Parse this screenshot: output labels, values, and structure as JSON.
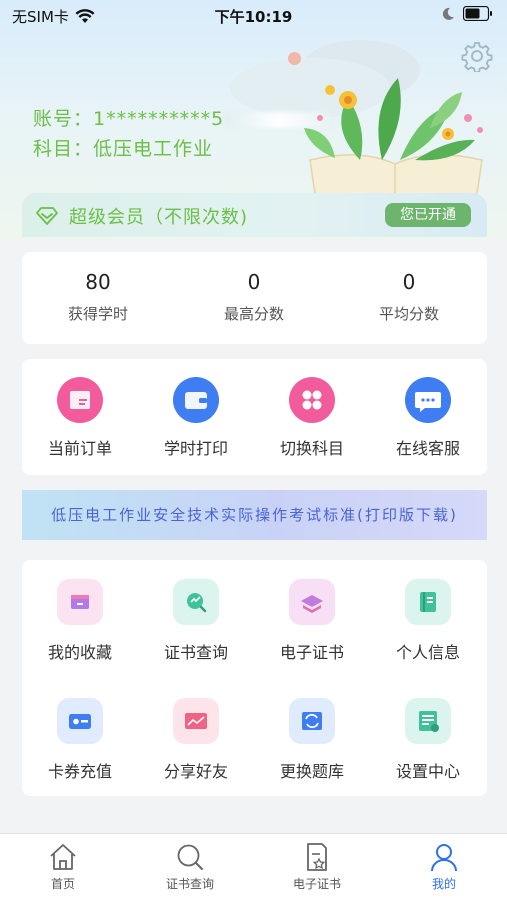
{
  "status_bar": {
    "carrier": "无SIM卡",
    "time": "下午10:19"
  },
  "profile": {
    "account_label": "账号：",
    "account_value": "1**********5",
    "subject_label": "科目：",
    "subject_value": "低压电工作业"
  },
  "vip": {
    "title": "超级会员（不限次数)",
    "badge": "您已开通"
  },
  "stats": [
    {
      "value": "80",
      "label": "获得学时"
    },
    {
      "value": "0",
      "label": "最高分数"
    },
    {
      "value": "0",
      "label": "平均分数"
    }
  ],
  "quick_actions": [
    {
      "label": "当前订单",
      "icon": "order-icon",
      "color": "#f25c9c"
    },
    {
      "label": "学时打印",
      "icon": "wallet-icon",
      "color": "#3f7ef2"
    },
    {
      "label": "切换科目",
      "icon": "switch-subject-icon",
      "color": "#f25c9c"
    },
    {
      "label": "在线客服",
      "icon": "chat-icon",
      "color": "#3f7ef2"
    }
  ],
  "banner": {
    "text": "低压电工作业安全技术实际操作考试标准(打印版下载)"
  },
  "grid_items": [
    {
      "label": "我的收藏",
      "icon": "favorites-icon"
    },
    {
      "label": "证书查询",
      "icon": "certificate-search-icon"
    },
    {
      "label": "电子证书",
      "icon": "e-certificate-icon"
    },
    {
      "label": "个人信息",
      "icon": "personal-info-icon"
    },
    {
      "label": "卡券充值",
      "icon": "card-recharge-icon"
    },
    {
      "label": "分享好友",
      "icon": "share-friends-icon"
    },
    {
      "label": "更换题库",
      "icon": "change-question-bank-icon"
    },
    {
      "label": "设置中心",
      "icon": "settings-center-icon"
    }
  ],
  "tabbar": {
    "active": "我的",
    "tabs": [
      {
        "label": "首页",
        "icon": "home-icon"
      },
      {
        "label": "证书查询",
        "icon": "search-icon"
      },
      {
        "label": "电子证书",
        "icon": "document-star-icon"
      },
      {
        "label": "我的",
        "icon": "user-icon"
      }
    ]
  },
  "colors": {
    "accent_green": "#6cbf46",
    "active_blue": "#2f6ff0",
    "badge_green": "#6db46d"
  }
}
